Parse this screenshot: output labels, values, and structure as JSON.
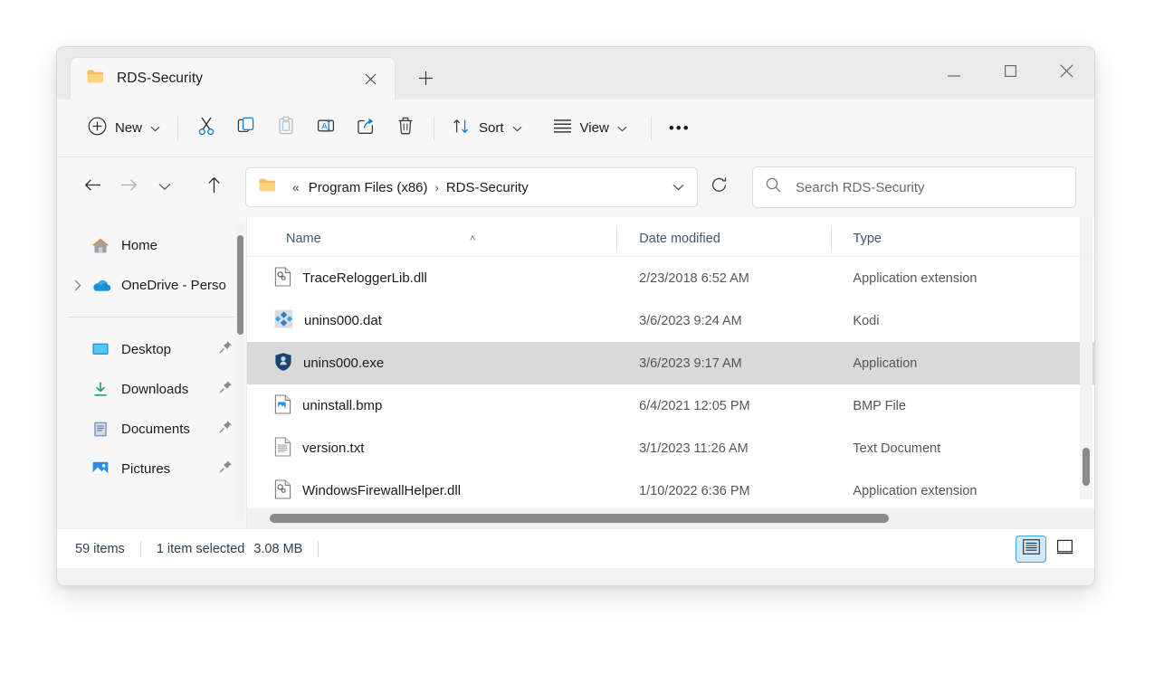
{
  "window": {
    "tab": {
      "title": "RDS-Security",
      "icon": "folder-icon",
      "close_icon": "close-icon"
    },
    "new_tab_icon": "plus-icon",
    "controls": {
      "minimize": "minimize-icon",
      "maximize": "maximize-icon",
      "close": "close-icon"
    }
  },
  "toolbar": {
    "new_label": "New",
    "new_icon": "plus-circle-icon",
    "new_chevron": "chevron-down-icon",
    "items": [
      {
        "name": "cut",
        "icon": "scissors-icon",
        "disabled": false
      },
      {
        "name": "copy",
        "icon": "copy-icon",
        "disabled": false
      },
      {
        "name": "paste",
        "icon": "paste-icon",
        "disabled": true
      },
      {
        "name": "rename",
        "icon": "rename-icon",
        "disabled": false
      },
      {
        "name": "share",
        "icon": "share-icon",
        "disabled": false
      },
      {
        "name": "delete",
        "icon": "trash-icon",
        "disabled": false
      }
    ],
    "sort_label": "Sort",
    "sort_icon": "sort-arrows-icon",
    "view_label": "View",
    "view_icon": "view-lines-icon",
    "overflow_label": "•••"
  },
  "address": {
    "back_icon": "arrow-left-icon",
    "forward_icon": "arrow-right-icon",
    "recent_icon": "chevron-down-icon",
    "up_icon": "arrow-up-icon",
    "folder_icon": "folder-icon",
    "overflow": "«",
    "crumbs": [
      "Program Files (x86)",
      "RDS-Security"
    ],
    "separator": "›",
    "dropdown_icon": "chevron-down-icon",
    "refresh_icon": "refresh-icon"
  },
  "search": {
    "icon": "search-icon",
    "placeholder": "Search RDS-Security",
    "value": ""
  },
  "sidebar": {
    "items": [
      {
        "label": "Home",
        "icon": "home-icon",
        "chevron": false,
        "pinned": false
      },
      {
        "label": "OneDrive - Perso",
        "icon": "onedrive-icon",
        "chevron": true,
        "pinned": false
      }
    ],
    "items2": [
      {
        "label": "Desktop",
        "icon": "desktop-icon",
        "pinned": true
      },
      {
        "label": "Downloads",
        "icon": "download-icon",
        "pinned": true
      },
      {
        "label": "Documents",
        "icon": "documents-icon",
        "pinned": true
      },
      {
        "label": "Pictures",
        "icon": "pictures-icon",
        "pinned": true
      }
    ]
  },
  "filelist": {
    "columns": [
      "Name",
      "Date modified",
      "Type"
    ],
    "sort_indicator": "˄",
    "rows": [
      {
        "name": "TraceReloggerLib.dll",
        "date": "2/23/2018 6:52 AM",
        "type": "Application extension",
        "icon": "dll-file-icon",
        "selected": false
      },
      {
        "name": "unins000.dat",
        "date": "3/6/2023 9:24 AM",
        "type": "Kodi",
        "icon": "kodi-file-icon",
        "selected": false
      },
      {
        "name": "unins000.exe",
        "date": "3/6/2023 9:17 AM",
        "type": "Application",
        "icon": "shield-app-icon",
        "selected": true
      },
      {
        "name": "uninstall.bmp",
        "date": "6/4/2021 12:05 PM",
        "type": "BMP File",
        "icon": "bmp-file-icon",
        "selected": false
      },
      {
        "name": "version.txt",
        "date": "3/1/2023 11:26 AM",
        "type": "Text Document",
        "icon": "text-file-icon",
        "selected": false
      },
      {
        "name": "WindowsFirewallHelper.dll",
        "date": "1/10/2022 6:36 PM",
        "type": "Application extension",
        "icon": "dll-file-icon",
        "selected": false
      }
    ]
  },
  "status": {
    "item_count": "59 items",
    "selection": "1 item selected",
    "size": "3.08 MB",
    "view_details_icon": "details-view-icon",
    "view_large_icon": "large-icons-view-icon"
  },
  "colors": {
    "accent": "#3da3e8",
    "selection": "#d9d9d9",
    "header_text": "#3f5873",
    "folder_yellow": "#f7c873"
  }
}
